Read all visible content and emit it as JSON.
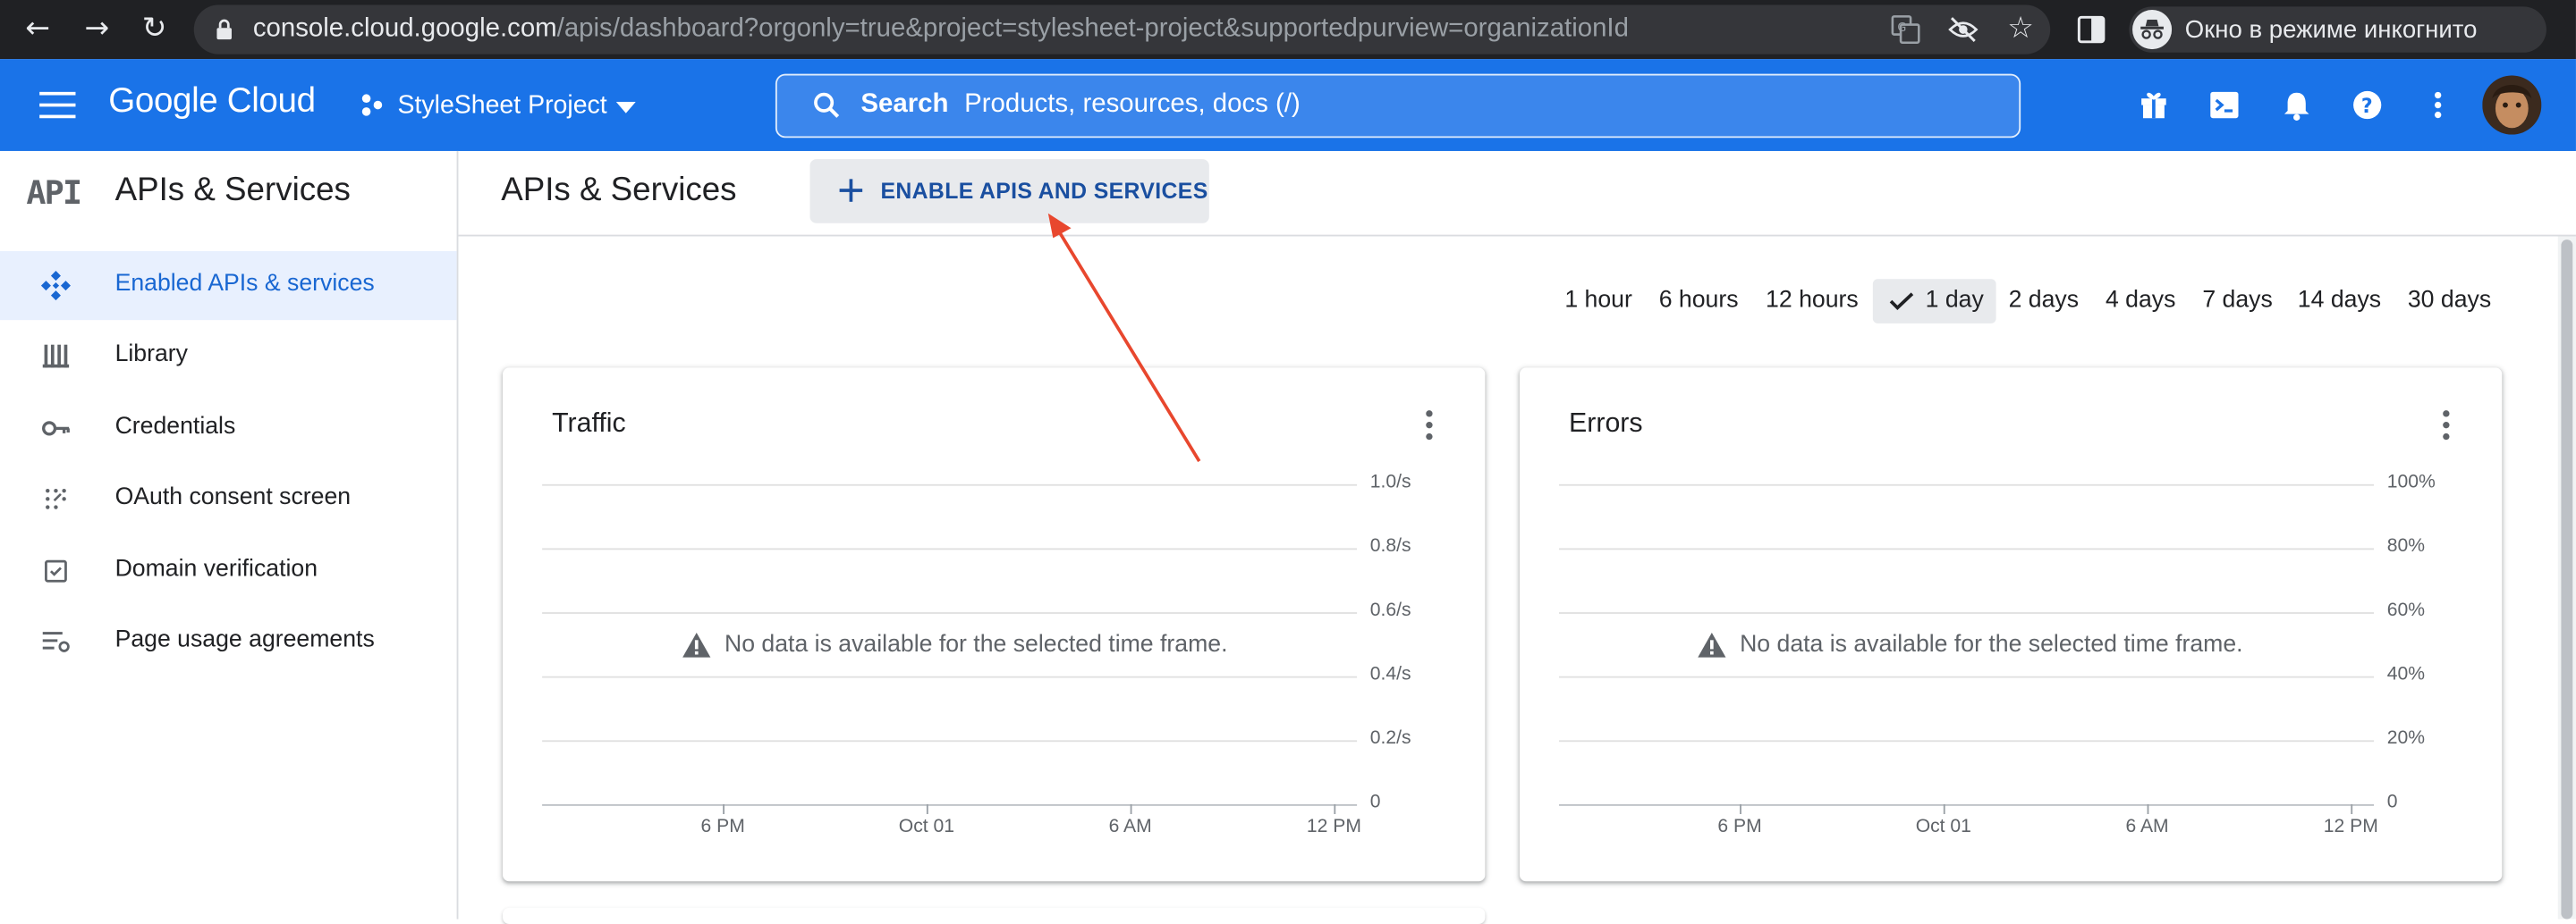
{
  "browser": {
    "url_domain": "console.cloud.google.com",
    "url_path": "/apis/dashboard?orgonly=true&project=stylesheet-project&supportedpurview=organizationId",
    "incognito_label": "Окно в режиме инкогнито"
  },
  "header": {
    "logo": "Google Cloud",
    "project": "StyleSheet Project",
    "search_label": "Search",
    "search_placeholder": "Products, resources, docs (/)",
    "accent": "#1a73e8"
  },
  "sidebar": {
    "badge": "API",
    "title": "APIs & Services",
    "items": [
      {
        "label": "Enabled APIs & services",
        "icon": "diamond-icon"
      },
      {
        "label": "Library",
        "icon": "library-icon"
      },
      {
        "label": "Credentials",
        "icon": "key-icon"
      },
      {
        "label": "OAuth consent screen",
        "icon": "dots-grid-icon"
      },
      {
        "label": "Domain verification",
        "icon": "checkbox-icon"
      },
      {
        "label": "Page usage agreements",
        "icon": "settings-list-icon"
      }
    ]
  },
  "main": {
    "title": "APIs & Services",
    "enable_button": "ENABLE APIS AND SERVICES",
    "time_ranges": [
      "1 hour",
      "6 hours",
      "12 hours",
      "1 day",
      "2 days",
      "4 days",
      "7 days",
      "14 days",
      "30 days"
    ],
    "selected_range": "1 day",
    "cards": [
      {
        "title": "Traffic",
        "no_data": "No data is available for the selected time frame.",
        "yticks": [
          "1.0/s",
          "0.8/s",
          "0.6/s",
          "0.4/s",
          "0.2/s",
          "0"
        ],
        "xticks": [
          "6 PM",
          "Oct 01",
          "6 AM",
          "12 PM"
        ]
      },
      {
        "title": "Errors",
        "no_data": "No data is available for the selected time frame.",
        "yticks": [
          "100%",
          "80%",
          "60%",
          "40%",
          "20%",
          "0"
        ],
        "xticks": [
          "6 PM",
          "Oct 01",
          "6 AM",
          "12 PM"
        ]
      }
    ]
  }
}
